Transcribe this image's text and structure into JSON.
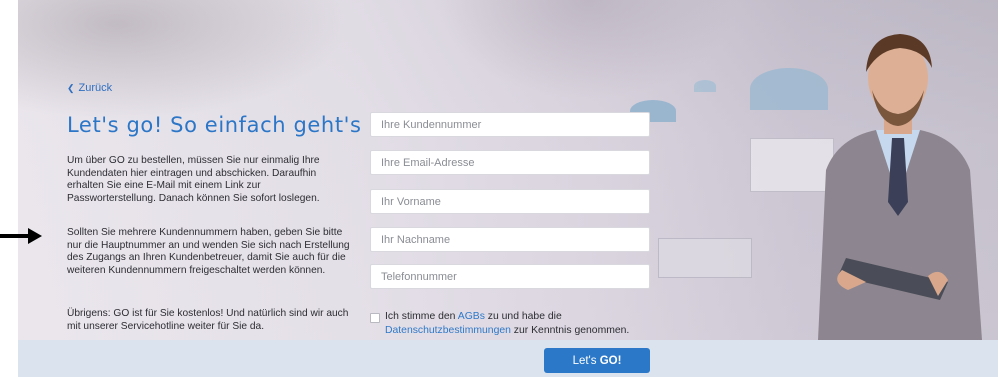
{
  "back_link": {
    "icon": "chevron-left-icon",
    "label": "Zurück"
  },
  "heading": "Let's go! So einfach geht's",
  "paragraphs": [
    "Um über GO zu bestellen, müssen Sie nur einmalig Ihre Kundendaten hier eintragen und abschicken. Daraufhin erhalten Sie eine E-Mail mit einem Link zur Passworterstellung. Danach können Sie sofort loslegen.",
    "Sollten Sie mehrere Kundennummern haben, geben Sie bitte nur die Hauptnummer an und wenden Sie sich nach Erstellung des Zugangs an Ihren Kundenbetreuer, damit Sie auch für die weiteren Kundennummern freigeschaltet werden können.",
    "Übrigens: GO ist für Sie kostenlos! Und natürlich sind wir auch mit unserer Servicehotline weiter für Sie da."
  ],
  "form": {
    "customer_number": {
      "placeholder": "Ihre Kundennummer",
      "value": ""
    },
    "email": {
      "placeholder": "Ihre Email-Adresse",
      "value": ""
    },
    "first_name": {
      "placeholder": "Ihr Vorname",
      "value": ""
    },
    "last_name": {
      "placeholder": "Ihr Nachname",
      "value": ""
    },
    "phone": {
      "placeholder": "Telefonnummer",
      "value": ""
    },
    "consent": {
      "checked": false,
      "prefix": "Ich stimme den ",
      "agb_link": "AGBs",
      "middle": " zu und habe die ",
      "privacy_link": "Datenschutzbestimmungen",
      "suffix": " zur Kenntnis genommen."
    },
    "submit": {
      "label_prefix": "Let's ",
      "label_bold": "GO!"
    }
  },
  "colors": {
    "accent": "#2b78c9",
    "heading": "#2c76c7",
    "footer_bar": "#dbe3ee",
    "text": "#2d2d33"
  },
  "decorations": {
    "pointer": "arrow-right-icon",
    "hero_image": "businessman-with-tablet-illustration"
  }
}
